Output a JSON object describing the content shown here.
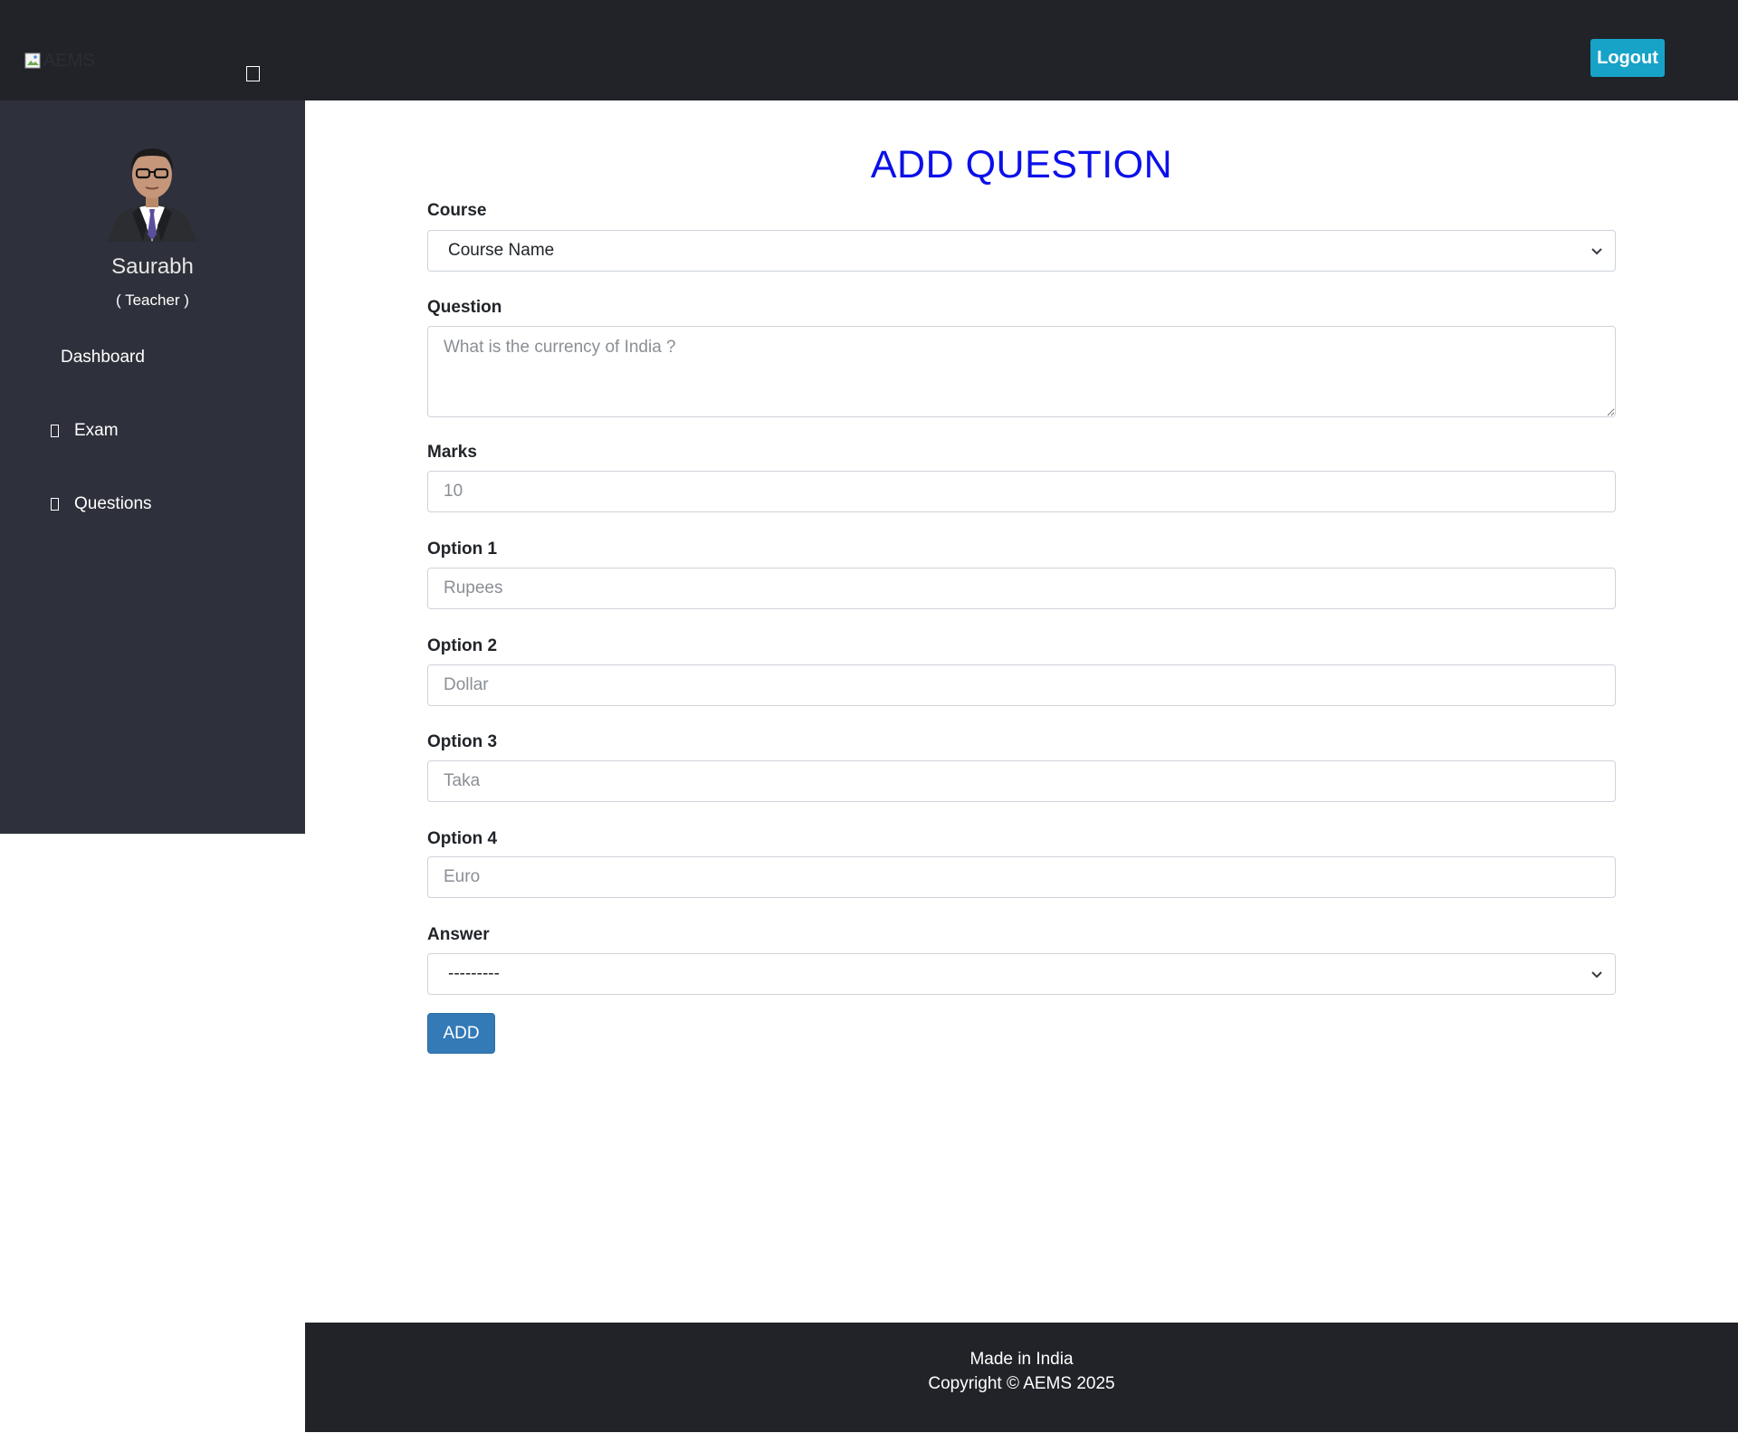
{
  "header": {
    "logo_alt": "AEMS",
    "logout_label": "Logout"
  },
  "sidebar": {
    "user_name": "Saurabh",
    "user_role": "( Teacher )",
    "items": [
      {
        "label": "Dashboard",
        "icon": "none"
      },
      {
        "label": "Exam",
        "icon": "missing-glyph-icon"
      },
      {
        "label": "Questions",
        "icon": "missing-glyph-icon"
      }
    ]
  },
  "main": {
    "title": "ADD QUESTION",
    "fields": {
      "course": {
        "label": "Course",
        "selected": "Course Name"
      },
      "question": {
        "label": "Question",
        "placeholder": "What is the currency of India ?"
      },
      "marks": {
        "label": "Marks",
        "placeholder": "10"
      },
      "option1": {
        "label": "Option 1",
        "placeholder": "Rupees"
      },
      "option2": {
        "label": "Option 2",
        "placeholder": "Dollar"
      },
      "option3": {
        "label": "Option 3",
        "placeholder": "Taka"
      },
      "option4": {
        "label": "Option 4",
        "placeholder": "Euro"
      },
      "answer": {
        "label": "Answer",
        "selected": "---------"
      }
    },
    "submit_label": "ADD"
  },
  "footer": {
    "line1": "Made in India",
    "line2": "Copyright © AEMS 2025"
  },
  "colors": {
    "topbar": "#212329",
    "sidebar": "#2e313b",
    "title": "#0b10ea",
    "logout": "#17a2c8",
    "add_button": "#337ab7"
  }
}
